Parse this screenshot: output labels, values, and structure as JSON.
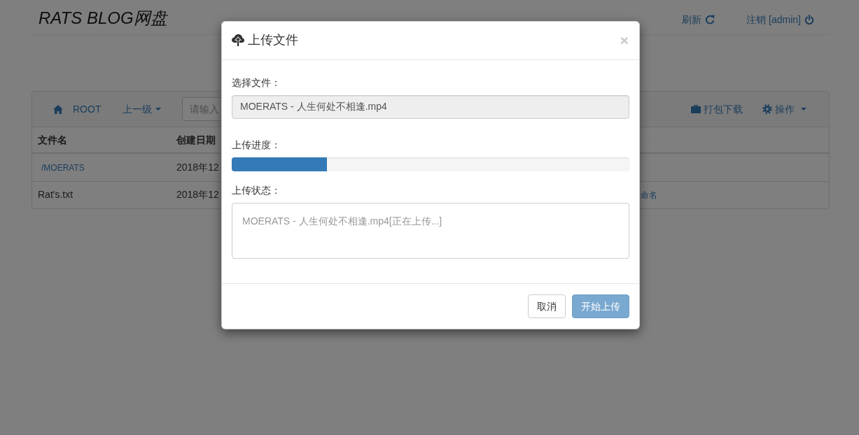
{
  "header": {
    "title": "RATS BLOG网盘",
    "links": [
      {
        "kind": "refresh",
        "label": "刷新"
      },
      {
        "kind": "logout",
        "label": "注销 [admin]"
      }
    ]
  },
  "toolbar": {
    "left": [
      {
        "kind": "home",
        "label": "ROOT"
      },
      {
        "kind": "dropdown",
        "label": "上一级"
      }
    ],
    "search": {
      "placeholder": "请输入"
    },
    "right": [
      {
        "kind": "package",
        "label": "打包下载"
      },
      {
        "kind": "settings",
        "label": "操作"
      }
    ]
  },
  "table": {
    "columns": [
      "文件名",
      "创建日期"
    ],
    "rows": [
      {
        "kind": "folder",
        "cells": [
          "/MOERATS",
          "2018年12"
        ]
      },
      {
        "kind": "file",
        "cells": [
          "Rat's.txt",
          "2018年12"
        ],
        "column_last": "命名"
      }
    ]
  },
  "modal": {
    "title": "上传文件",
    "close": "×",
    "fields": [
      {
        "kind": "input",
        "label": "选择文件：",
        "value": "MOERATS - 人生何处不相逢.mp4",
        "disabled": true
      },
      {
        "kind": "progress",
        "label": "上传进度：",
        "level": 0.24
      },
      {
        "kind": "textarea",
        "label": "上传状态：",
        "placeholder": "MOERATS - 人生何处不相逢.mp4[正在上传...]"
      }
    ],
    "buttons": [
      {
        "kind": "default",
        "label": "取消",
        "disabled": false
      },
      {
        "kind": "primary",
        "label": "开始上传",
        "disabled": true
      }
    ]
  }
}
